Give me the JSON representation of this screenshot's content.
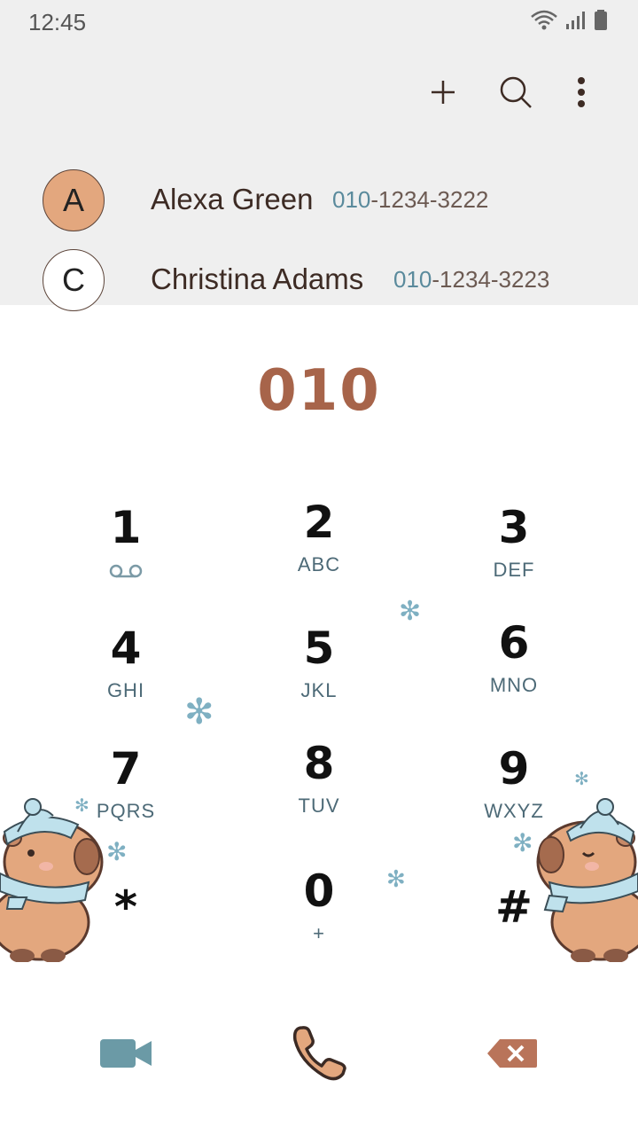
{
  "status_bar": {
    "time": "12:45"
  },
  "toolbar": {
    "add_icon": "plus-icon",
    "search_icon": "search-icon",
    "more_icon": "more-vertical-icon"
  },
  "contacts": [
    {
      "initial": "A",
      "name": "Alexa Green",
      "number_match": "010",
      "number_rest": "-1234-3222",
      "avatar_color": "#e3a77e"
    },
    {
      "initial": "C",
      "name": "Christina Adams",
      "number_match": "010",
      "number_rest": "-1234-3223",
      "avatar_color": "#ffffff"
    }
  ],
  "dialer": {
    "input": "010"
  },
  "keypad": [
    {
      "digit": "1",
      "letters": ""
    },
    {
      "digit": "2",
      "letters": "ABC"
    },
    {
      "digit": "3",
      "letters": "DEF"
    },
    {
      "digit": "4",
      "letters": "GHI"
    },
    {
      "digit": "5",
      "letters": "JKL"
    },
    {
      "digit": "6",
      "letters": "MNO"
    },
    {
      "digit": "7",
      "letters": "PQRS"
    },
    {
      "digit": "8",
      "letters": "TUV"
    },
    {
      "digit": "9",
      "letters": "WXYZ"
    },
    {
      "digit": "*",
      "letters": ""
    },
    {
      "digit": "0",
      "letters": "+"
    },
    {
      "digit": "#",
      "letters": ""
    }
  ],
  "colors": {
    "accent": "#a7644a",
    "keypad_letters": "#4d6a77",
    "video": "#6b9aa6",
    "call": "#e3a77e",
    "backspace": "#b9745a",
    "top_bg": "#efefef"
  }
}
